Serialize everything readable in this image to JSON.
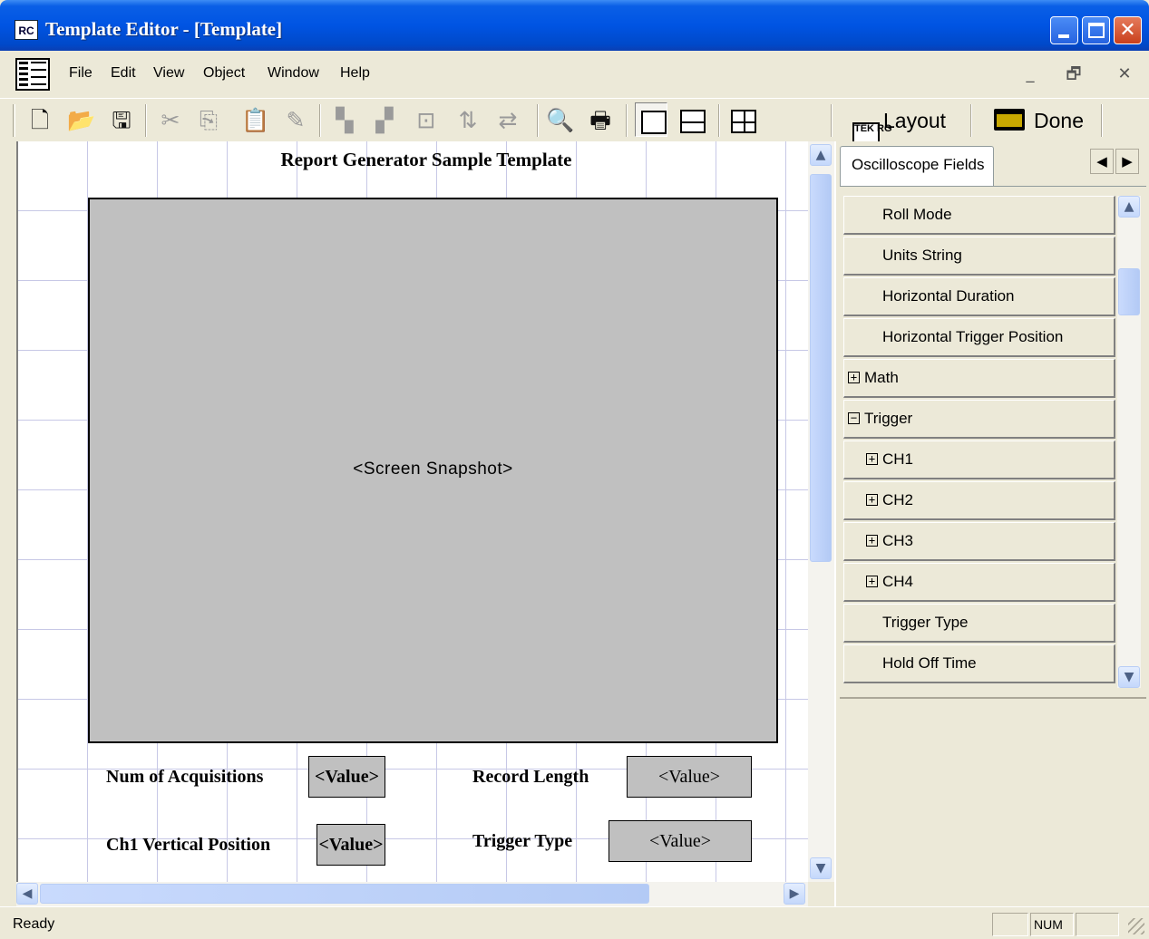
{
  "window": {
    "app_icon_text": "RC",
    "title": "Template Editor - [Template]",
    "min_glyph": "",
    "close_glyph": "✕"
  },
  "menu": {
    "items": [
      "File",
      "Edit",
      "View",
      "Object",
      "Window",
      "Help"
    ],
    "mdi_min": "_",
    "mdi_restore": "🗗",
    "mdi_close": "✕"
  },
  "toolbar": {
    "icons": {
      "new": "🗋",
      "open": "📂",
      "save": "🖫",
      "cut": "✂",
      "copy": "⎘",
      "paste": "📋",
      "erase": "✎",
      "bring_front": "▚",
      "send_back": "▞",
      "group": "⊡",
      "align1": "⇅",
      "align2": "⇄",
      "preview": "🔍",
      "print": "🖶"
    },
    "layout_label": "Layout",
    "rg_icon_text": "TEK RG",
    "done_label": "Done"
  },
  "template": {
    "title": "Report Generator Sample Template",
    "snapshot_placeholder": "<Screen Snapshot>",
    "fields": [
      {
        "label": "Num of Acquisitions",
        "value": "<Value>"
      },
      {
        "label": "Record Length",
        "value": "<Value>"
      },
      {
        "label": "Ch1 Vertical Position",
        "value": "<Value>"
      },
      {
        "label": "Trigger Type",
        "value": "<Value>"
      }
    ]
  },
  "panel": {
    "tab_label": "Oscilloscope Fields",
    "prev_arrow": "◀",
    "next_arrow": "▶",
    "items": [
      {
        "label": "Roll Mode",
        "toggle": ""
      },
      {
        "label": "Units String",
        "toggle": ""
      },
      {
        "label": "Horizontal Duration",
        "toggle": ""
      },
      {
        "label": "Horizontal Trigger Position",
        "toggle": ""
      },
      {
        "label": "Math",
        "toggle": "+"
      },
      {
        "label": "Trigger",
        "toggle": "−"
      },
      {
        "label": "CH1",
        "toggle": "+"
      },
      {
        "label": "CH2",
        "toggle": "+"
      },
      {
        "label": "CH3",
        "toggle": "+"
      },
      {
        "label": "CH4",
        "toggle": "+"
      },
      {
        "label": "Trigger Type",
        "toggle": ""
      },
      {
        "label": "Hold Off Time",
        "toggle": ""
      }
    ]
  },
  "scroll": {
    "up": "▲",
    "down": "▼",
    "left": "◀",
    "right": "▶"
  },
  "status": {
    "text": "Ready",
    "num": "NUM"
  }
}
